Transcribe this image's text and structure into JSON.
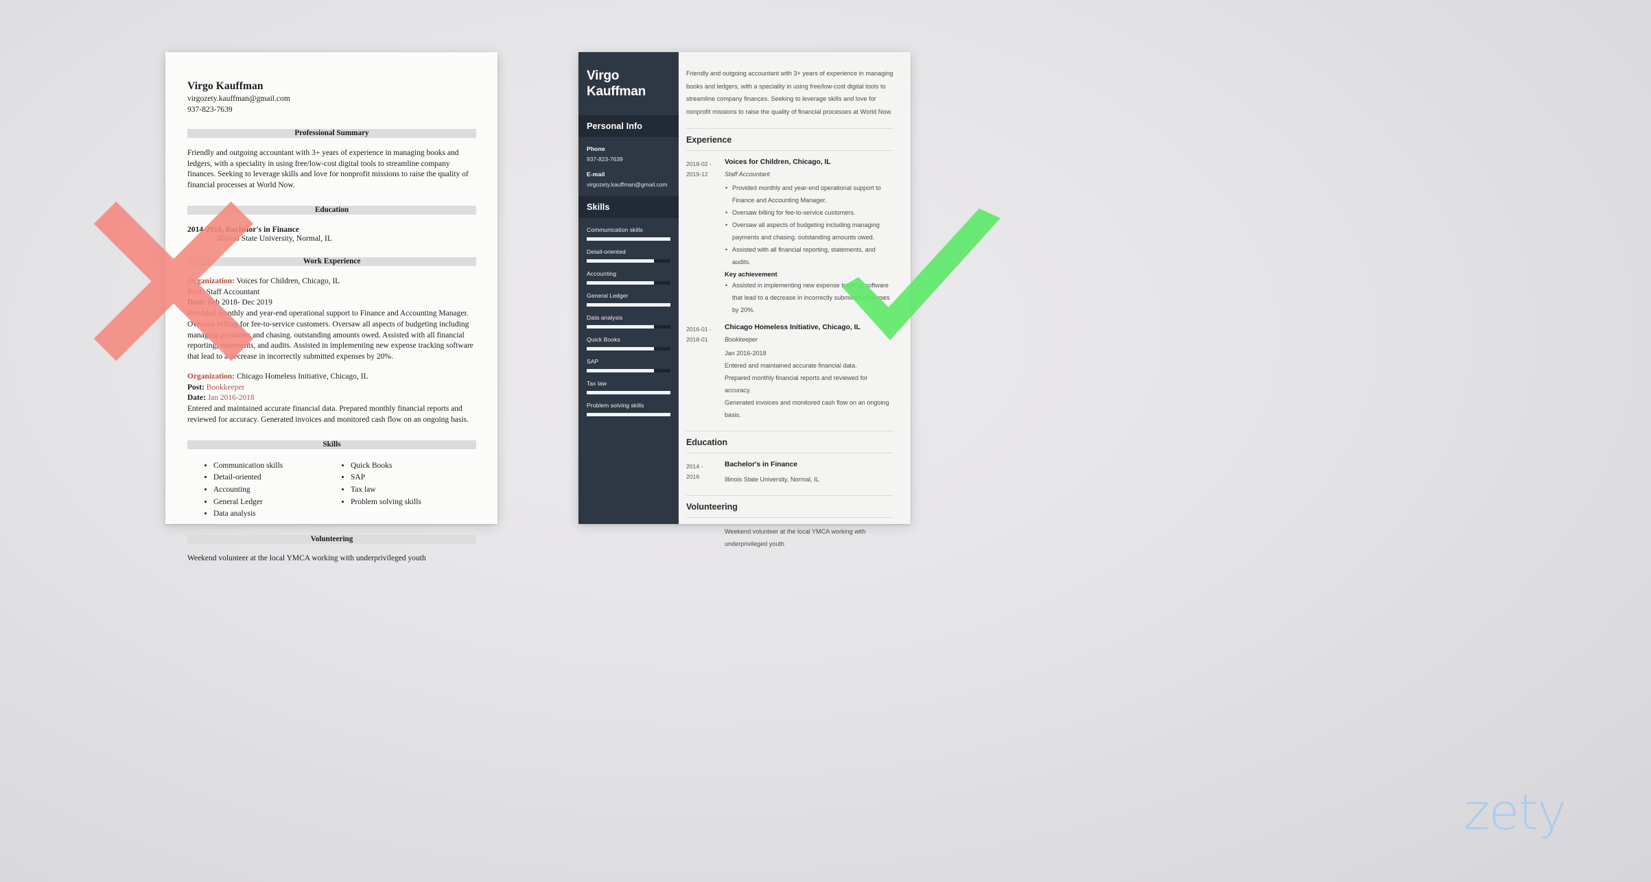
{
  "brand": {
    "logo_text": "zety",
    "logo_color": "#a8cdee"
  },
  "marks": {
    "wrong_icon": "x-mark-icon",
    "wrong_color": "#f4897f",
    "right_icon": "check-mark-icon",
    "right_color": "#5ee86a"
  },
  "bad_resume": {
    "name": "Virgo Kauffman",
    "email": "virgozety.kauffman@gmail.com",
    "phone": "937-823-7639",
    "sections": {
      "summary_heading": "Professional Summary",
      "summary_text": "Friendly and outgoing accountant with 3+ years of experience in managing books and ledgers, with a speciality in using free/low-cost digital tools to streamline company finances. Seeking to leverage skills and love for nonprofit missions to raise the quality of financial processes at World Now.",
      "education_heading": "Education",
      "education_degree": "2014-2016, Bachelor's in Finance",
      "education_school": "Illinois State University, Normal, IL",
      "work_heading": "Work Experience",
      "jobs": [
        {
          "org_label": "Organization:",
          "org_value": " Voices for Children, Chicago, IL",
          "post_label": "Post:",
          "post_value": " Staff Accountant",
          "date_label": "Date:",
          "date_value": " Feb 2018- Dec 2019",
          "description": "Provided monthly and year-end operational support to Finance and Accounting Manager. Oversaw billing for fee-to-service customers. Oversaw all aspects of budgeting including managing payments and chasing. outstanding amounts owed. Assisted with all financial reporting, statements, and audits. Assisted in implementing new expense tracking software that lead to a decrease in incorrectly submitted expenses by 20%."
        },
        {
          "org_label": "Organization:",
          "org_value": " Chicago Homeless Initiative, Chicago, IL",
          "post_label": "Post:",
          "post_value": " Bookkeeper",
          "date_label": "Date:",
          "date_value": " Jan 2016-2018",
          "description": "Entered and maintained accurate financial data. Prepared monthly financial reports and reviewed for accuracy. Generated invoices and monitored cash flow on an ongoing basis."
        }
      ],
      "skills_heading": "Skills",
      "skills_col1": [
        "Communication skills",
        "Detail-oriented",
        "Accounting",
        "General Ledger",
        "Data analysis"
      ],
      "skills_col2": [
        "Quick Books",
        "SAP",
        "Tax law",
        "Problem solving skills"
      ],
      "volunteering_heading": "Volunteering",
      "volunteering_text": "Weekend volunteer at the local YMCA working with underprivileged youth"
    }
  },
  "good_resume": {
    "sidebar": {
      "name_line1": "Virgo",
      "name_line2": "Kauffman",
      "personal_info_heading": "Personal Info",
      "phone_label": "Phone",
      "phone_value": "937-823-7639",
      "email_label": "E-mail",
      "email_value": "virgozety.kauffman@gmail.com",
      "skills_heading": "Skills",
      "skills": [
        {
          "label": "Communication skills",
          "level": 100
        },
        {
          "label": "Detail-oriented",
          "level": 80
        },
        {
          "label": "Accounting",
          "level": 80
        },
        {
          "label": "General Ledger",
          "level": 100
        },
        {
          "label": "Data analysis",
          "level": 80
        },
        {
          "label": "Quick Books",
          "level": 80
        },
        {
          "label": "SAP",
          "level": 80
        },
        {
          "label": "Tax law",
          "level": 100
        },
        {
          "label": "Problem solving skills",
          "level": 100
        }
      ]
    },
    "main": {
      "summary": "Friendly and outgoing accountant with 3+ years of experience in managing books and ledgers, with a speciality in using free/low-cost digital tools to streamline company finances. Seeking to leverage skills and love for nonprofit missions to raise the quality of financial processes at World Now.",
      "experience_heading": "Experience",
      "experience": [
        {
          "date_from": "2018-02 -",
          "date_to": "2019-12",
          "org": "Voices for Children, Chicago, IL",
          "role": "Staff Accountant",
          "bullets": [
            "Provided monthly and year-end operational support to Finance and Accounting Manager.",
            "Oversaw billing for fee-to-service customers.",
            "Oversaw all aspects of budgeting including managing payments and chasing. outstanding amounts owed.",
            "Assisted with all financial reporting, statements, and audits."
          ],
          "key_achievement_label": "Key achievement",
          "key_achievement": "Assisted in implementing new expense tracking software that lead to a decrease in incorrectly submitted expenses by 20%."
        },
        {
          "date_from": "2016-01 -",
          "date_to": "2018-01",
          "org": "Chicago Homeless Initiative, Chicago, IL",
          "role": "Bookkeeper",
          "lines": [
            "Jan 2016-2018",
            "Entered and maintained accurate financial data.",
            "Prepared monthly financial reports and reviewed for accuracy.",
            "Generated invoices and monitored cash flow on an ongoing basis."
          ]
        }
      ],
      "education_heading": "Education",
      "education": {
        "date_from": "2014 -",
        "date_to": "2016",
        "degree": "Bachelor's in Finance",
        "school": "Illinois State University, Normal, IL"
      },
      "volunteering_heading": "Volunteering",
      "volunteering_text": "Weekend volunteer at the local YMCA working with underprivileged youth"
    }
  }
}
